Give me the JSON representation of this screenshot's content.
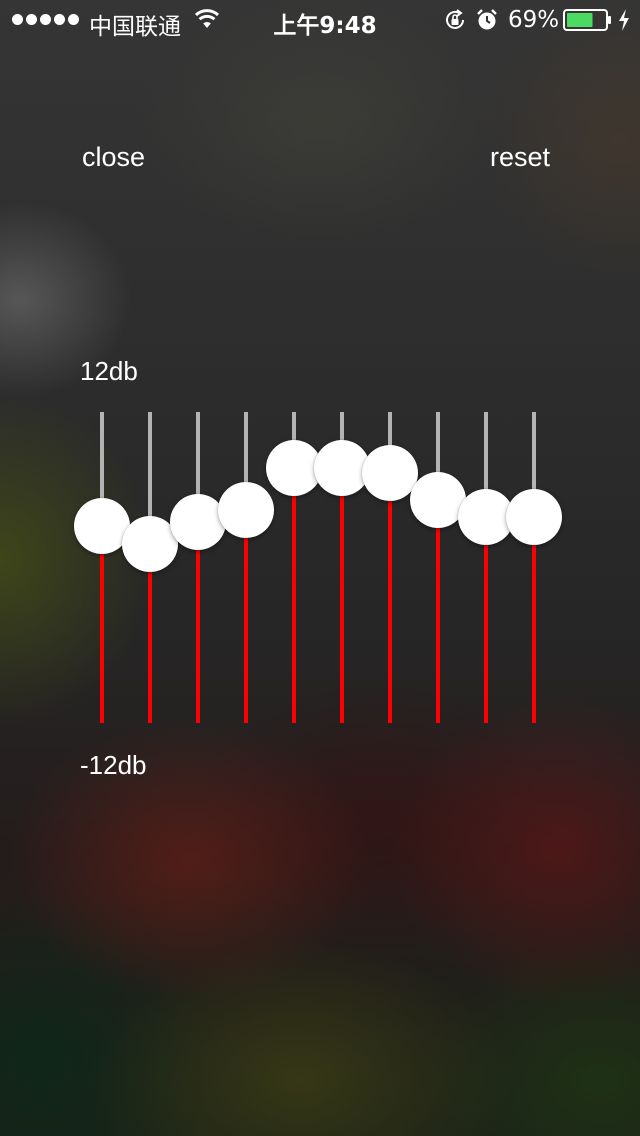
{
  "status_bar": {
    "carrier": "中国联通",
    "time": "上午9:48",
    "battery_percent": "69%",
    "battery_level": 0.69,
    "signal_dots": 5,
    "icons": [
      "wifi-icon",
      "rotation-lock-icon",
      "alarm-icon",
      "battery-icon",
      "charging-icon"
    ]
  },
  "controls": {
    "close_label": "close",
    "reset_label": "reset"
  },
  "scale": {
    "max_label": "12db",
    "min_label": "-12db",
    "max_db": 12,
    "min_db": -12
  },
  "equalizer": {
    "band_values_db": [
      3.2,
      1.8,
      3.5,
      4.4,
      7.7,
      7.7,
      7.3,
      5.2,
      3.9,
      3.9
    ]
  },
  "colors": {
    "active_track": "#ff0000",
    "inactive_track": "#b3b3b3",
    "knob": "#ffffff",
    "text": "#ffffff"
  }
}
